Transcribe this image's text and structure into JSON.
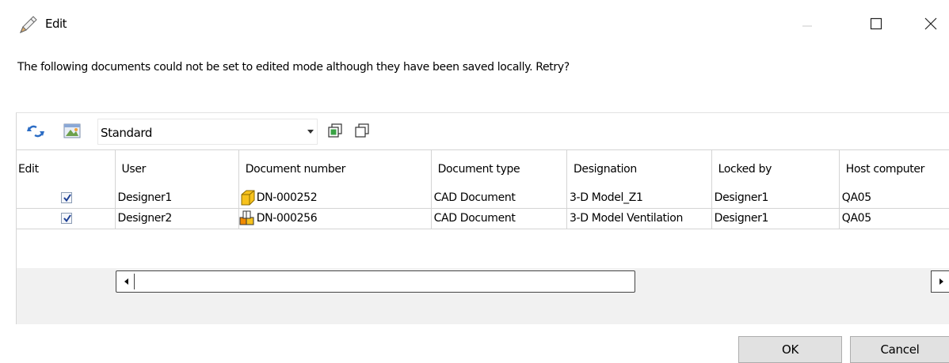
{
  "window": {
    "title": "Edit",
    "icon": "pencil-icon"
  },
  "message": "The following documents could not be set to edited mode although they have been saved locally. Retry?",
  "toolbar": {
    "view_select": {
      "selected": "Standard"
    }
  },
  "table": {
    "headers": [
      "Edit",
      "User",
      "Document number",
      "Document type",
      "Designation",
      "Locked by",
      "Host computer"
    ],
    "rows": [
      {
        "edit": true,
        "user": "Designer1",
        "document_number": "DN-000252",
        "document_icon": "part-icon",
        "document_type": "CAD Document",
        "designation": "3-D Model_Z1",
        "locked_by": "Designer1",
        "host_computer": "QA05"
      },
      {
        "edit": true,
        "user": "Designer2",
        "document_number": "DN-000256",
        "document_icon": "assembly-icon",
        "document_type": "CAD Document",
        "designation": "3-D Model Ventilation",
        "locked_by": "Designer1",
        "host_computer": "QA05"
      }
    ]
  },
  "buttons": {
    "ok": "OK",
    "cancel": "Cancel"
  },
  "colors": {
    "checkmark": "#1c3f94",
    "part_icon": "#f7c21c",
    "assembly_icon_accent": "#f08a00"
  }
}
